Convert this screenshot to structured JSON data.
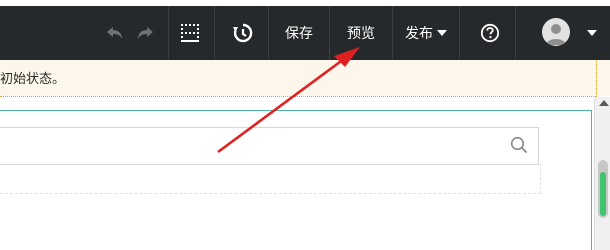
{
  "toolbar": {
    "undo_icon": "undo-icon",
    "redo_icon": "redo-icon",
    "grid_icon": "grid-icon",
    "history_icon": "history-icon",
    "save_label": "保存",
    "preview_label": "预览",
    "publish_label": "发布",
    "help_icon": "help-icon",
    "avatar_icon": "user-avatar-icon",
    "menu_caret_icon": "caret-down-icon"
  },
  "notice": {
    "text": "初始状态。"
  },
  "search": {
    "value": "",
    "placeholder": ""
  },
  "colors": {
    "toolbar_bg": "#26292c",
    "notice_bg": "#fdf6ea",
    "annotation_arrow": "#e02020",
    "scroll_accent": "#3ec46d"
  }
}
